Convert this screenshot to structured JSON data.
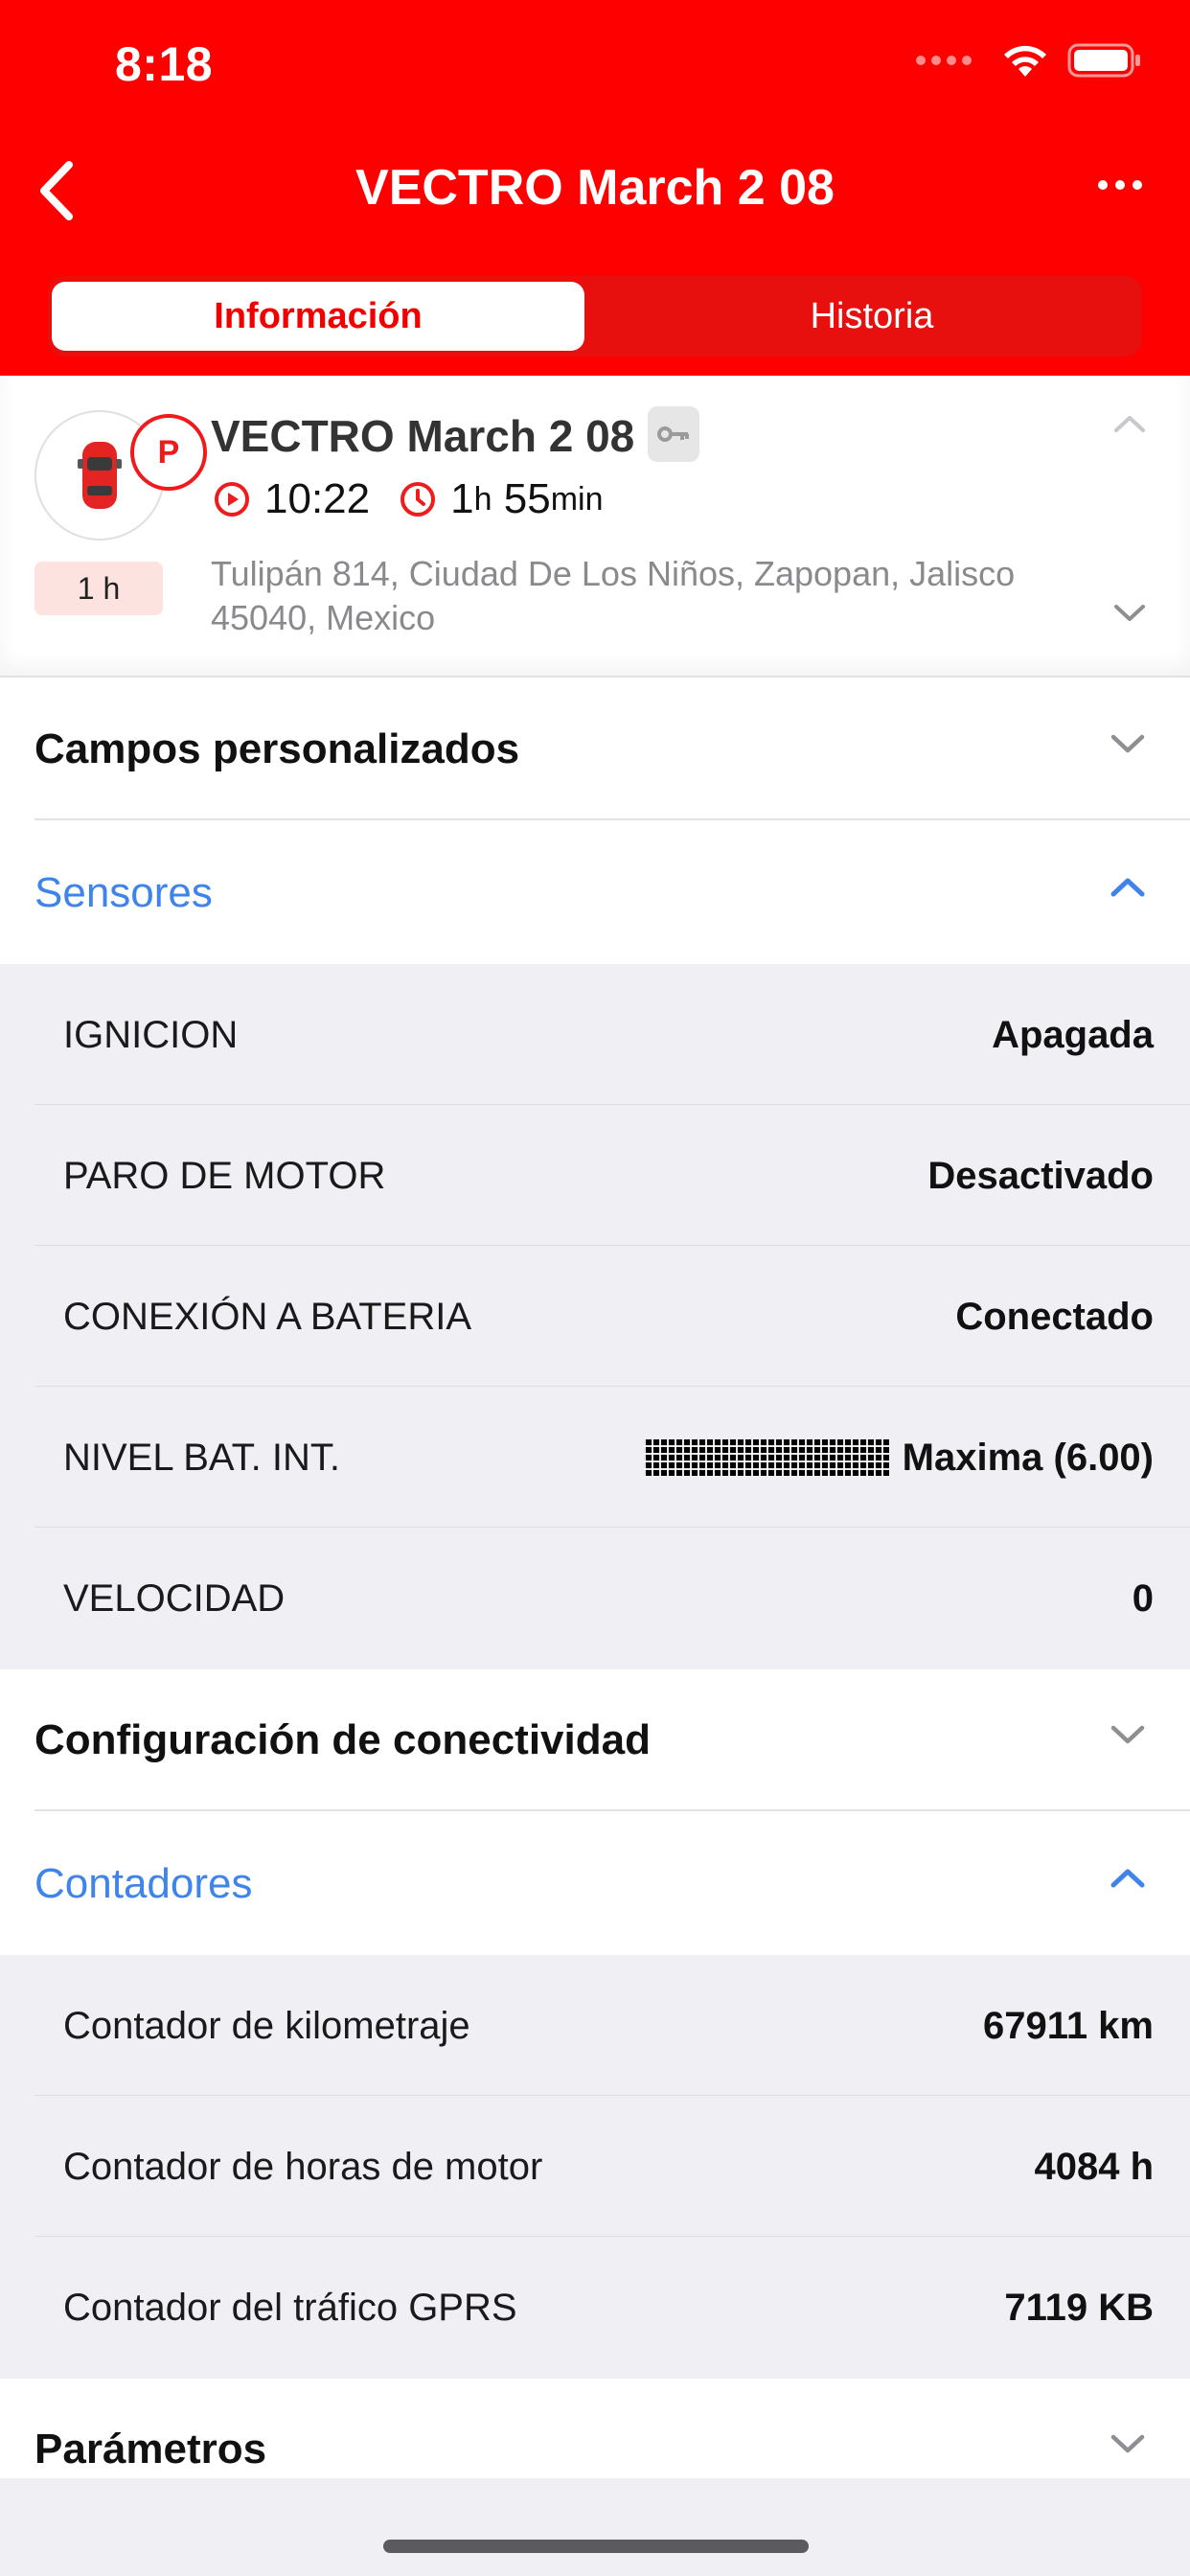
{
  "status_bar": {
    "time": "8:18"
  },
  "nav": {
    "title": "VECTRO March 2 08"
  },
  "tabs": [
    {
      "label": "Información",
      "active": true
    },
    {
      "label": "Historia",
      "active": false
    }
  ],
  "vehicle": {
    "name": "VECTRO March 2 08",
    "park_badge": "P",
    "duration_pill": "1 h",
    "time": "10:22",
    "duration_hours": "1",
    "duration_h_unit": "h",
    "duration_minutes": "55",
    "duration_min_unit": "min",
    "address": "Tulipán 814, Ciudad De Los Niños, Zapopan, Jalisco 45040, Mexico"
  },
  "sections": {
    "custom_fields": {
      "title": "Campos personalizados"
    },
    "sensors": {
      "title": "Sensores",
      "rows": [
        {
          "label": "IGNICION",
          "value": "Apagada"
        },
        {
          "label": "PARO DE MOTOR",
          "value": "Desactivado"
        },
        {
          "label": "CONEXIÓN A BATERIA",
          "value": "Conectado"
        },
        {
          "label": "NIVEL BAT. INT.",
          "value": "Maxima (6.00)"
        },
        {
          "label": "VELOCIDAD",
          "value": "0"
        }
      ]
    },
    "connectivity": {
      "title": "Configuración de conectividad"
    },
    "counters": {
      "title": "Contadores",
      "rows": [
        {
          "label": "Contador de kilometraje",
          "value": "67911 km"
        },
        {
          "label": "Contador de horas de motor",
          "value": "4084 h"
        },
        {
          "label": "Contador del tráfico GPRS",
          "value": "7119 KB"
        }
      ]
    },
    "parameters": {
      "title": "Parámetros"
    }
  },
  "colors": {
    "brand_red": "#fe0000",
    "accent_blue": "#3e84ea",
    "pill_bg": "#fde3df"
  }
}
